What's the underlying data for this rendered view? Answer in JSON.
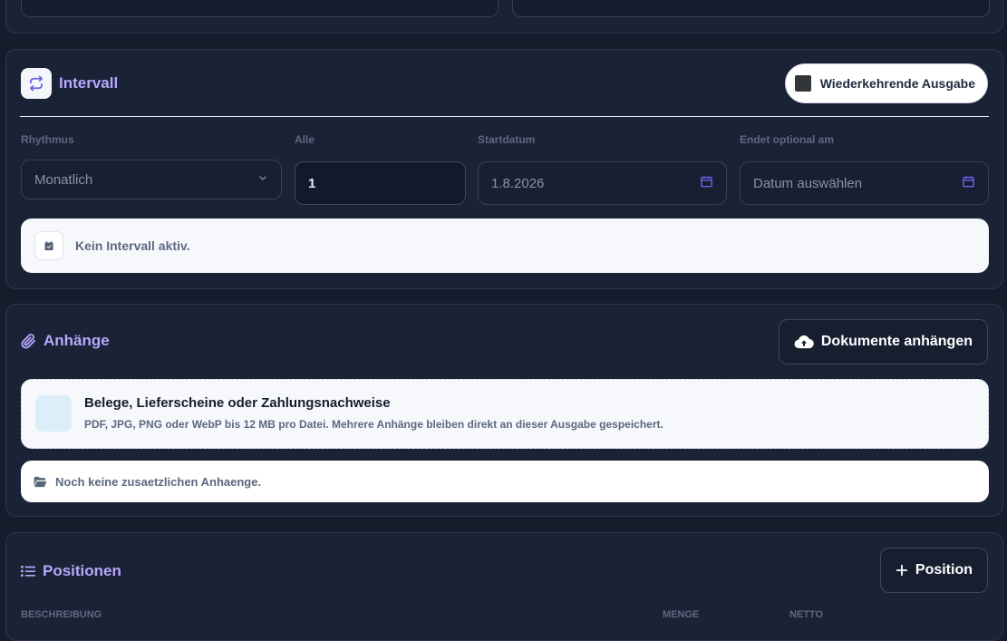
{
  "intervall": {
    "title": "Intervall",
    "toggle_label": "Wiederkehrende Ausgabe",
    "rhythmus": {
      "label": "Rhythmus",
      "value": "Monatlich"
    },
    "alle": {
      "label": "Alle",
      "value": "1"
    },
    "startdatum": {
      "label": "Startdatum",
      "value": "1.8.2026"
    },
    "endet": {
      "label": "Endet optional am",
      "placeholder": "Datum auswählen"
    },
    "status_text": "Kein Intervall aktiv."
  },
  "anhaenge": {
    "title": "Anhänge",
    "upload_button": "Dokumente anhängen",
    "dropzone_title": "Belege, Lieferscheine oder Zahlungsnachweise",
    "dropzone_hint": "PDF, JPG, PNG oder WebP bis 12 MB pro Datei. Mehrere Anhänge bleiben direkt an dieser Ausgabe gespeichert.",
    "empty_text": "Noch keine zusaetzlichen Anhaenge."
  },
  "positionen": {
    "title": "Positionen",
    "add_button": "Position",
    "columns": [
      "BESCHREIBUNG",
      "MENGE",
      "NETTO"
    ]
  },
  "colors": {
    "accent": "#b7a7ff",
    "icon_accent": "#6c63e6",
    "background": "#151c2c"
  }
}
